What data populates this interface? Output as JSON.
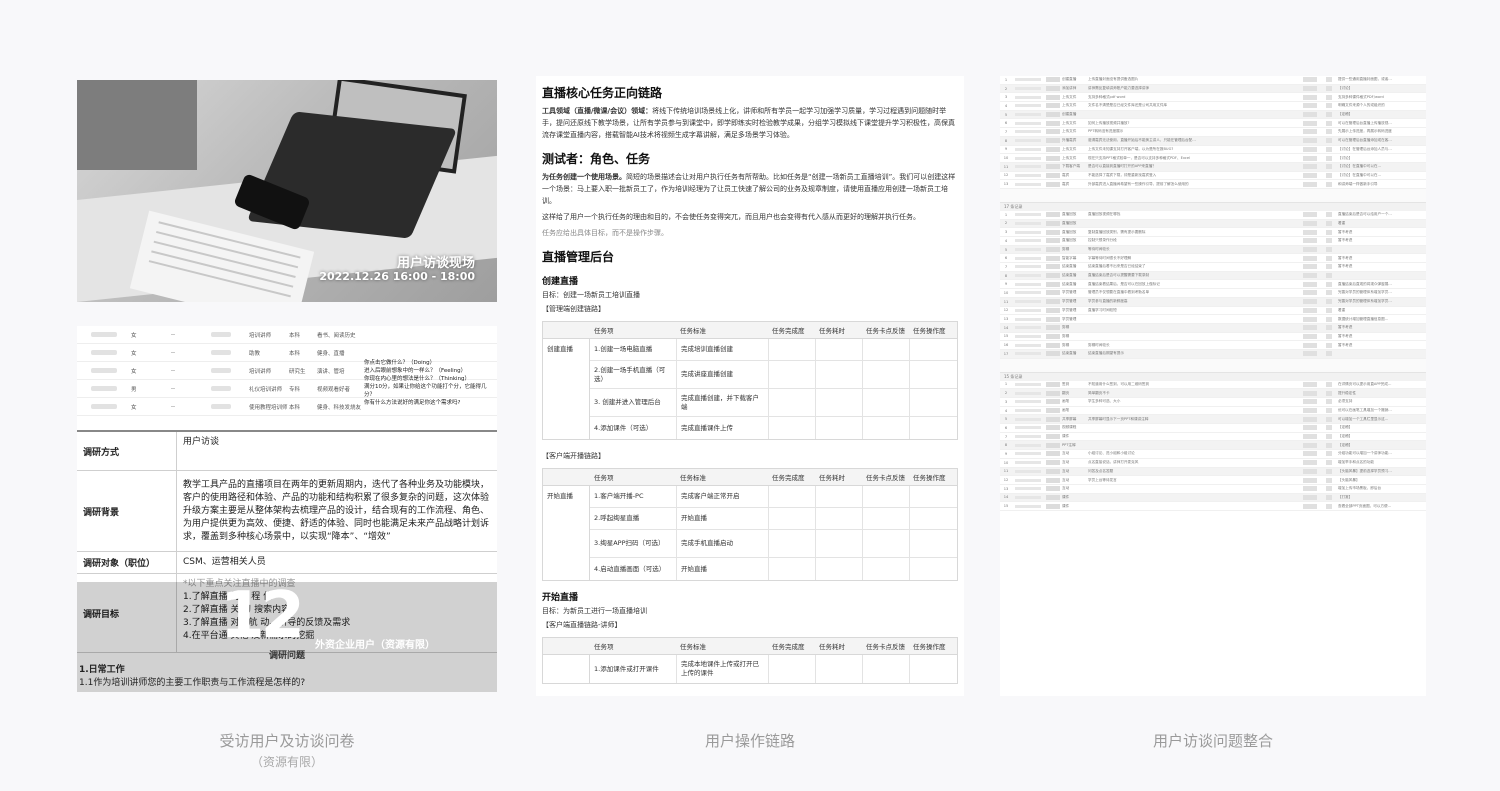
{
  "panel1": {
    "photo_title": "用户访谈现场",
    "photo_date": "2022.12.26 16:00 - 18:00",
    "participants": [
      {
        "gender": "女",
        "role": "培训讲师",
        "edu": "本科",
        "hobby": "看书、阅读历史"
      },
      {
        "gender": "女",
        "role": "助教",
        "edu": "本科",
        "hobby": "健身、直播"
      },
      {
        "gender": "女",
        "role": "培训讲师",
        "edu": "研究生",
        "hobby": "演讲、管培"
      },
      {
        "gender": "男",
        "role": "礼仪培训讲师",
        "edu": "专科",
        "hobby": "视频观看好者"
      },
      {
        "gender": "女",
        "role": "使用教程培训师",
        "edu": "本科",
        "hobby": "健身、科技发烧友"
      }
    ],
    "qa_note": [
      "你点击它做什么？（Doing）",
      "进入后眼前想象中的一样么？（Feeling）",
      "你现在内心里的想法是什么？（Thinking）",
      "满分10分，如果让你给这个功能打个分，它能得几分？",
      "你有什么方法说好的满足你这个需求吗?"
    ],
    "survey": {
      "method_label": "调研方式",
      "method_value": "用户访谈",
      "background_label": "调研背景",
      "background_value": "教学工具产品的直播项目在两年的更新周期内，迭代了各种业务及功能模块，客户的使用路径和体验、产品的功能和结构积累了很多复杂的问题，这次体验升级方案主要是从整体架构去梳理产品的设计，结合现有的工作流程、角色、为用户提供更为高效、便捷、舒适的体验、同时也能满足未来产品战略计划诉求，覆盖到多种核心场景中，以实现“降本”、“增效”",
      "target_label": "调研对象（职位）",
      "target_value": "CSM、运营相关人员",
      "goal_label": "调研目标",
      "goal_note": "*以下重点关注直播中的调查",
      "goal_items": [
        "1.了解直播      的主      程      位",
        "2.了解直播      关      习      搜索内容",
        "3.了解直播      对导航       动、引导的反馈及需求",
        "4.在平台通      其他       及新需求的挖掘"
      ]
    },
    "overlay_number": "12",
    "overlay_text": "外资企业用户（资源有限）",
    "questions_head": "调研问题",
    "section_title": "1.日常工作",
    "section_q": "1.1作为培训讲师您的主要工作职责与工作流程是怎样的?"
  },
  "panel2": {
    "title": "直播核心任务正向链路",
    "intro_bold": "工具领域（直播/微课/会议）领域：",
    "intro": "将线下传统培训场景线上化，讲师和所有学员一起学习加强学习质量，学习过程遇到问题随时举手，提问还原线下教学场景，让所有学员参与到课堂中，即学即练实时检验教学成果，分组学习模拟线下课堂提升学习积极性，高保真流存课堂直播内容，搭载智能AI技术将视频生成字幕讲解，满足多场景学习体验。",
    "testers_title": "测试者：角色、任务",
    "tasks_bold": "为任务创建一个使用场景。",
    "tasks_p1": "简短的场景描述会让对用户执行任务有所帮助。比如任务是“创建一场新员工直播培训”。我们可以创建这样一个场景：马上要入职一批新员工了，作为培训经理为了让员工快速了解公司的业务及规章制度，请使用直播应用创建一场新员工培训。",
    "tasks_p2": "这样给了用户一个执行任务的理由和目的，不会使任务变得突兀，而且用户也会变得有代入感从而更好的理解并执行任务。",
    "tasks_p3": "任务应给出具体目标，而不是操作步骤。",
    "admin_title": "直播管理后台",
    "create_title": "创建直播",
    "create_goal": "目标：创建一场新员工培训直播",
    "admin_link": "【管理端创建链路】",
    "headers": [
      "任务项",
      "任务标准",
      "任务完成度",
      "任务耗时",
      "任务卡点反馈",
      "任务操作度"
    ],
    "table1_first": "创建直播",
    "table1_rows": [
      {
        "item": "1.创建一场电脑直播",
        "std": "完成培训直播创建"
      },
      {
        "item": "2.创建一场手机直播（可选）",
        "std": "完成讲座直播创建"
      },
      {
        "item": "3. 创建并进入管理后台",
        "std": "完成直播创建，并下载客户端"
      },
      {
        "item": "4.添加课件（可选）",
        "std": "完成直播课件上传"
      }
    ],
    "client_link": "【客户端开播链路】",
    "table2_first": "开始直播",
    "table2_rows": [
      {
        "item": "1.客户端开播-PC",
        "std": "完成客户端正常开启"
      },
      {
        "item": "2.呼起绚星直播",
        "std": "开始直播"
      },
      {
        "item": "3.绚星APP扫码（可选）",
        "std": "完成手机直播启动"
      },
      {
        "item": "4.启动直播画面（可选）",
        "std": "开始直播"
      }
    ],
    "start_title": "开始直播",
    "start_goal": "目标：为新员工进行一场直播培训",
    "lecturer_link": "【客户端直播链路-讲师】",
    "table3_rows": [
      {
        "item": "1.添加课件或打开课件",
        "std": "完成本地课件上传或打开已上传的课件"
      }
    ]
  },
  "panel3": {
    "group_a": [
      {
        "cat": "创建直播",
        "text": "上传直播封面没有提供备选图片",
        "note": "提供一些通用直播封面图，或者…"
      },
      {
        "cat": "添加讲师",
        "text": "讲师需反复填讲师账户能力要选择讲师",
        "note": "【讨论】"
      },
      {
        "cat": "上传文件",
        "text": "支持多种格式pdf word",
        "note": "支持多种课件格式PDF/word"
      },
      {
        "cat": "上传文件",
        "text": "文件名不清楚是否已经文件库还是公司共用文件库",
        "note": "明确文件来源个人的或组织的"
      },
      {
        "cat": "创建直播",
        "text": "",
        "note": "【定稿】"
      },
      {
        "cat": "上传文件",
        "text": "如何上传播放视频并播放?",
        "note": "可以在管理后台直播上传播放视…"
      },
      {
        "cat": "上传文件",
        "text": "PPT转码没有进度展示",
        "note": "先展示上传进度，再展示转码进度"
      },
      {
        "cat": "外播嘉宾",
        "text": "邀请嘉宾无法使用，直播开始后不能换主讲人，只能在管理后台配…",
        "note": "可以在管理后台直播添加或在客…"
      },
      {
        "cat": "上传文件",
        "text": "上传文件未知课支持打开客户端，以为是所在报BUG?",
        "note": "【讨论】在管理后台添加人员与…"
      },
      {
        "cat": "上传文件",
        "text": "现在只支持PPT格式较单一，是否可以支持多种格式PDF、Excel",
        "note": "【讨论】"
      },
      {
        "cat": "下载客户端",
        "text": "是否可以直接到直播时打开的APP来直播？",
        "note": "【讨论】在直播中可以在…"
      },
      {
        "cat": "嘉宾",
        "text": "不能选择了嘉宾下载，却是重新找嘉宾登入",
        "note": "【讨论】在直播中可以在…"
      },
      {
        "cat": "嘉宾",
        "text": "外部嘉宾进入直播间希望有一些操作引导，提前了解怎么使用的",
        "note": "和讲师端一样做新手引导"
      }
    ],
    "group_b_label": "17 条记录",
    "group_b": [
      {
        "cat": "直播回放",
        "text": "直播回放视频在哪找",
        "note": "直播结束后是否可以给用户一个…"
      },
      {
        "cat": "直播回放",
        "text": "",
        "note": "看重"
      },
      {
        "cat": "直播回放",
        "text": "复制直播回放类别，需有提示要删除",
        "note": "暂不考虑"
      },
      {
        "cat": "直播回放",
        "text": "控制只想录作分段",
        "note": "暂不考虑"
      },
      {
        "cat": "剪辑",
        "text": "等待时间较长",
        "note": ""
      },
      {
        "cat": "智能字幕",
        "text": "字幕等待时间很长不好理解",
        "note": "暂不考虑"
      },
      {
        "cat": "结束直播",
        "text": "结束直播后看不出来是否已经结束了",
        "note": "暂不考虑"
      },
      {
        "cat": "结束直播",
        "text": "直播结束后是否可以提醒需要下载录制",
        "note": ""
      },
      {
        "cat": "结束直播",
        "text": "直播结束看结果后，是否可以在回放上做标记",
        "note": "直播结束后直观的将观众弹窗展…"
      },
      {
        "cat": "学员管理",
        "text": "管理员不仅想要在直播中看到考勤名单",
        "note": "完善对学员的管理体系增加学员…"
      },
      {
        "cat": "学员管理",
        "text": "学员参与直播的新鲜度高",
        "note": "完善对学员的管理体系增加学员…"
      },
      {
        "cat": "学员管理",
        "text": "直播学习时间较短",
        "note": "看重"
      },
      {
        "cat": "学员管理",
        "text": "",
        "note": "数据统计增加管理直播信息图…"
      },
      {
        "cat": "剪辑",
        "text": "",
        "note": "暂不考虑"
      },
      {
        "cat": "剪辑",
        "text": "",
        "note": "暂不考虑"
      },
      {
        "cat": "剪辑",
        "text": "剪辑时间较长",
        "note": "暂不考虑"
      },
      {
        "cat": "结束直播",
        "text": "结束直播后期望有提示",
        "note": ""
      }
    ],
    "group_c_label": "15 条记录",
    "group_c": [
      {
        "cat": "签到",
        "text": "不知道用什么签到，可以用二维码签到",
        "note": "在详情页可以提示用直APP完成…"
      },
      {
        "cat": "翻页",
        "text": "简单翻页不卡",
        "note": "提升稳定性"
      },
      {
        "cat": "画笔",
        "text": "学生多种可选、大小",
        "note": "必须支持"
      },
      {
        "cat": "画笔",
        "text": "",
        "note": "优可以在画笔工具增加一个撤销…"
      },
      {
        "cat": "共享屏幕",
        "text": "共享屏幕时显示下一页PPT和课讲注释",
        "note": "可以增加一个工具栏里显示这…"
      },
      {
        "cat": "视频课程",
        "text": "",
        "note": "【定稿】"
      },
      {
        "cat": "课件",
        "text": "",
        "note": "【定稿】"
      },
      {
        "cat": "PPT注释",
        "text": "",
        "note": "【定稿】"
      },
      {
        "cat": "互动",
        "text": "小组讨论、进小组和小组讨论",
        "note": "分组功能可以增加一个讲师功能…"
      },
      {
        "cat": "互动",
        "text": "点名直接说话，讲师打开麦克风",
        "note": "增加举手和点名的功能"
      },
      {
        "cat": "互动",
        "text": "问答及点名答题",
        "note": "【头脑风暴】提前选择学员预习…"
      },
      {
        "cat": "互动",
        "text": "学员上台等待发言",
        "note": "【头脑风暴】"
      },
      {
        "cat": "互动",
        "text": "",
        "note": "增加上传市场黑板，即后台"
      },
      {
        "cat": "课件",
        "text": "",
        "note": "【打赏】"
      },
      {
        "cat": "课件",
        "text": "",
        "note": "查看全部PPT页面图，可以方便…"
      }
    ]
  },
  "captions": {
    "left": "受访用户及访谈问卷",
    "left_sub": "（资源有限）",
    "middle": "用户操作链路",
    "right": "用户访谈问题整合"
  }
}
